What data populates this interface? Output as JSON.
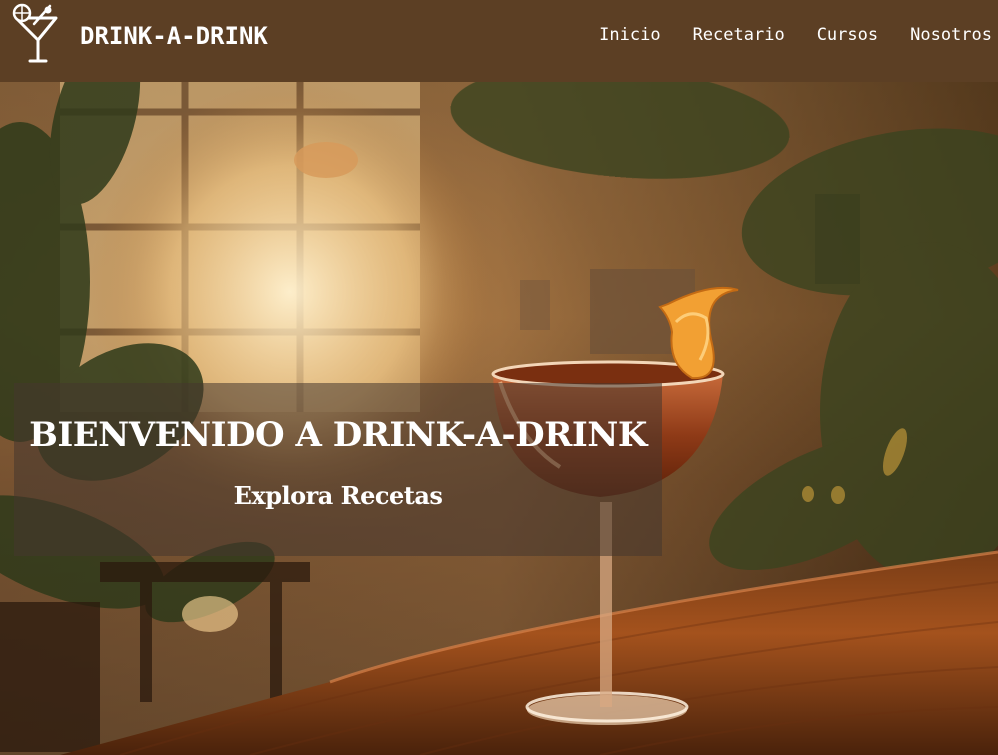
{
  "navbar": {
    "brand": "DRINK-A-DRINK",
    "logo_icon": "cocktail-glass-icon",
    "links": [
      {
        "label": "Inicio"
      },
      {
        "label": "Recetario"
      },
      {
        "label": "Cursos"
      },
      {
        "label": "Nosotros"
      }
    ],
    "background": "#5c3f24",
    "text_color": "#ffffff"
  },
  "hero": {
    "title": "BIENVENIDO A DRINK-A-DRINK",
    "subtitle": "Explora Recetas",
    "image": "cocktail-on-bar-photo",
    "overlay_color": "#46372d"
  }
}
